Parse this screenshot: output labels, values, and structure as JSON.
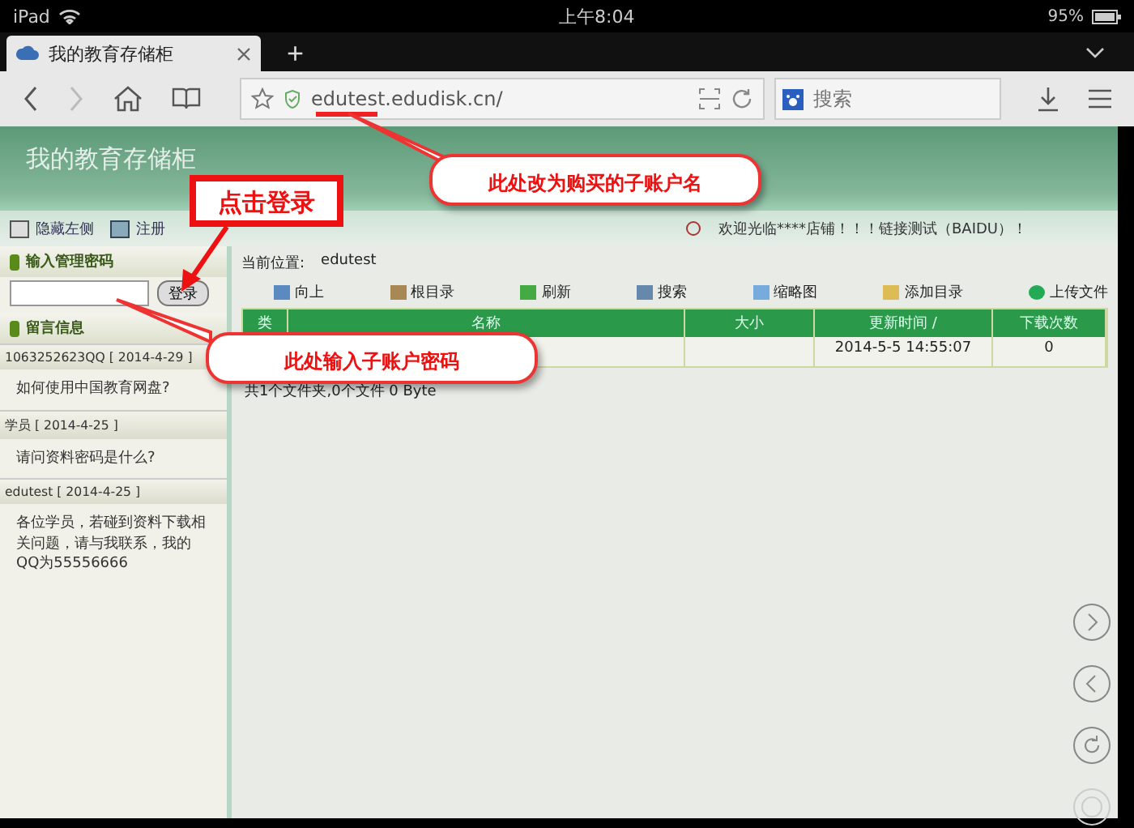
{
  "status_bar": {
    "device": "iPad",
    "time": "上午8:04",
    "battery": "95%"
  },
  "browser_tab": {
    "title": "我的教育存储柜",
    "new_tab": "+"
  },
  "address_bar": {
    "url": "edutest.edudisk.cn/",
    "search_placeholder": "搜索"
  },
  "site_header": {
    "title": "我的教育存储柜",
    "links": [
      "隐藏左侧",
      "注册"
    ],
    "marquee": "欢迎光临****店铺！！！链接测试（BAIDU）！"
  },
  "sidebar": {
    "password_label": "输入管理密码",
    "login_button": "登录",
    "messages_label": "留言信息",
    "messages": [
      {
        "author": "1063252623QQ [ 2014-4-29 ]",
        "text": "如何使用中国教育网盘?"
      },
      {
        "author": "学员 [ 2014-4-25 ]",
        "text": "请问资料密码是什么?"
      },
      {
        "author": "edutest [ 2014-4-25 ]",
        "text": "各位学员，若碰到资料下载相关问题，请与我联系，我的QQ为55556666"
      }
    ]
  },
  "main": {
    "location_label": "当前位置:",
    "location": "edutest",
    "toolbar": [
      "向上",
      "根目录",
      "刷新",
      "搜索",
      "缩略图",
      "添加目录",
      "上传文件"
    ],
    "columns": [
      "类",
      "名称",
      "大小",
      "更新时间 /",
      "下载次数"
    ],
    "rows": [
      {
        "cells": [
          "",
          "",
          "",
          "2014-5-5 14:55:07",
          "0"
        ]
      }
    ],
    "summary": "共1个文件夹,0个文件 0 Byte"
  },
  "annotations": [
    {
      "kind": "bubble",
      "text": "此处改为购买的子账户名"
    },
    {
      "kind": "box",
      "text": "点击登录"
    },
    {
      "kind": "bubble",
      "text": "此处输入子账户密码"
    }
  ]
}
